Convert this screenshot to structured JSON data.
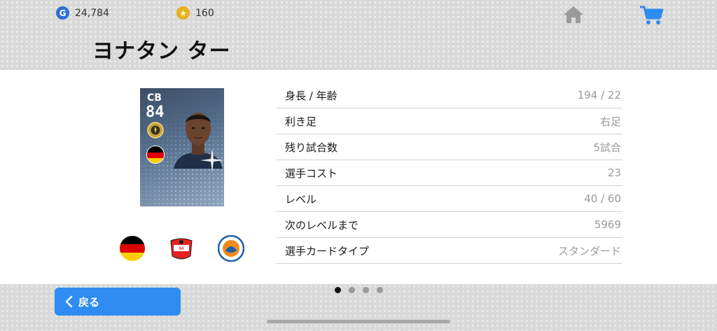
{
  "currency": {
    "gp_icon": "G",
    "gp_value": "24,784",
    "coins_icon": "★",
    "coins_value": "160"
  },
  "header": {
    "home_icon": "home-icon",
    "cart_icon": "cart-icon",
    "player_name": "ヨナタン ター"
  },
  "player_card": {
    "position": "CB",
    "rating": "84",
    "nationality": "Germany",
    "flag_colors": [
      "#000000",
      "#dd0000",
      "#ffce00"
    ]
  },
  "affiliations": {
    "nation_icon": "germany-flag-icon",
    "club_icon": "club-crest-icon",
    "league_icon": "league-logo-icon"
  },
  "info": [
    {
      "label": "身長 / 年齢",
      "value": "194 / 22"
    },
    {
      "label": "利き足",
      "value": "右足"
    },
    {
      "label": "残り試合数",
      "value": "5試合"
    },
    {
      "label": "選手コスト",
      "value": "23"
    },
    {
      "label": "レベル",
      "value": "40 / 60"
    },
    {
      "label": "次のレベルまで",
      "value": "5969"
    },
    {
      "label": "選手カードタイプ",
      "value": "スタンダード"
    }
  ],
  "footer": {
    "back_label": "戻る",
    "page_count": 4,
    "active_page": 1
  },
  "colors": {
    "accent": "#2f8cf0",
    "gp": "#2f6fd6",
    "coin": "#e6b21c"
  }
}
